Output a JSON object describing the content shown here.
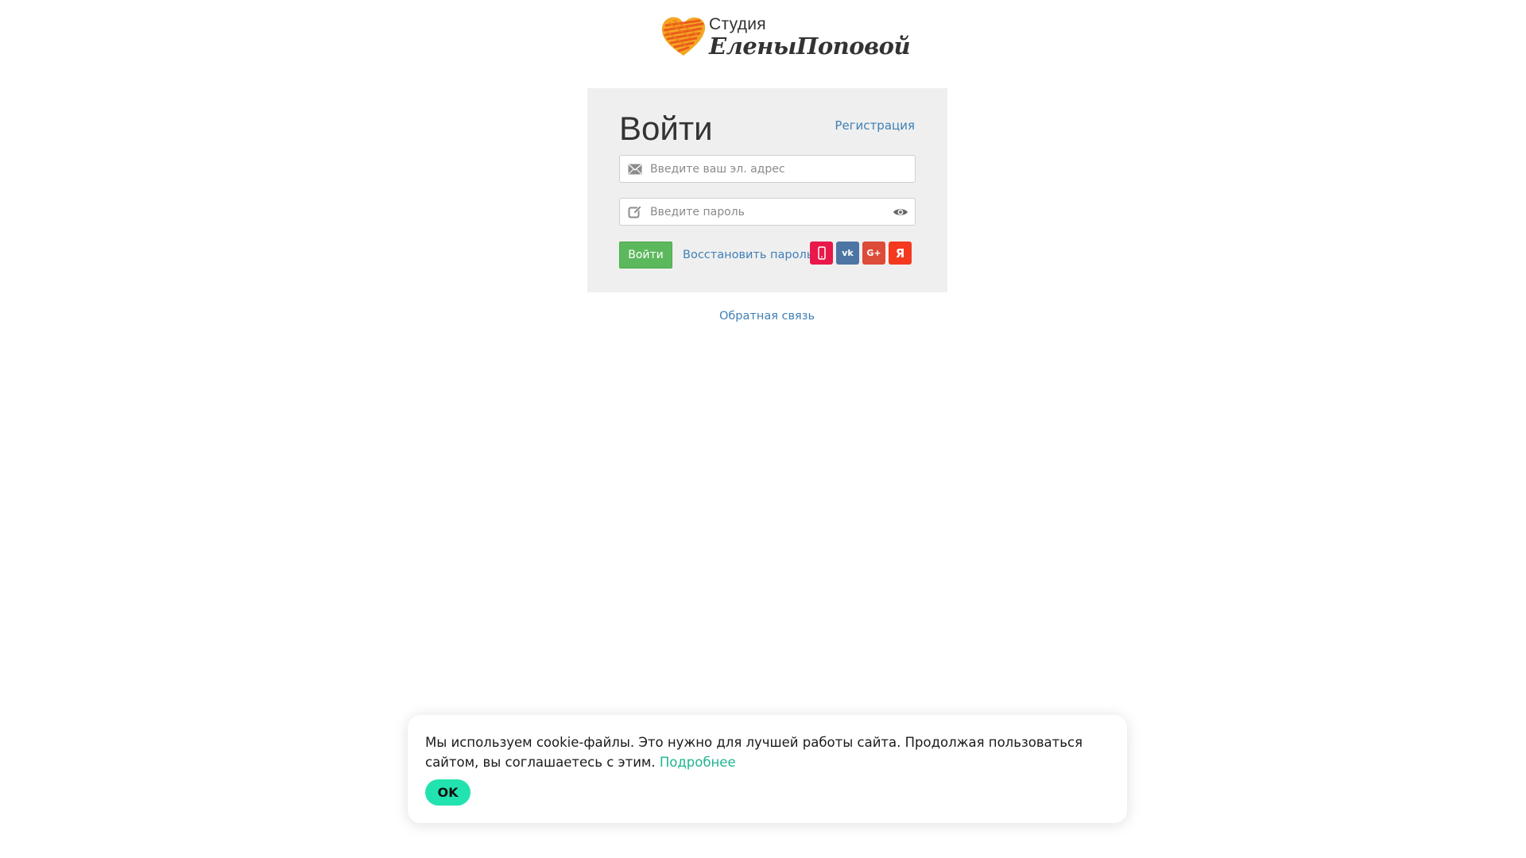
{
  "logo": {
    "line1": "Студия",
    "line2": "ЕленыПоповой",
    "heart_colors": [
      "#f5a623",
      "#f07a1a",
      "#e8501a"
    ]
  },
  "login": {
    "title": "Войти",
    "register_link": "Регистрация",
    "email_placeholder": "Введите ваш эл. адрес",
    "password_placeholder": "Введите пароль",
    "submit_label": "Войти",
    "restore_link": "Восстановить пароль",
    "social": [
      {
        "name": "phone",
        "icon": "phone-icon",
        "color": "#e8184a"
      },
      {
        "name": "vk",
        "label": "vk",
        "icon": "vk-icon",
        "color": "#4c75a3"
      },
      {
        "name": "google-plus",
        "label": "G+",
        "icon": "google-plus-icon",
        "color": "#dd4b39"
      },
      {
        "name": "yandex",
        "label": "Я",
        "icon": "yandex-icon",
        "color": "#f5391e"
      }
    ]
  },
  "feedback_link": "Обратная связь",
  "cookie": {
    "text": "Мы используем cookie-файлы. Это нужно для лучшей работы сайта. Продолжая пользоваться сайтом, вы соглашаетесь с этим.",
    "more_link": "Подробнее",
    "ok_label": "OK",
    "accent_color": "#22e3b0"
  }
}
